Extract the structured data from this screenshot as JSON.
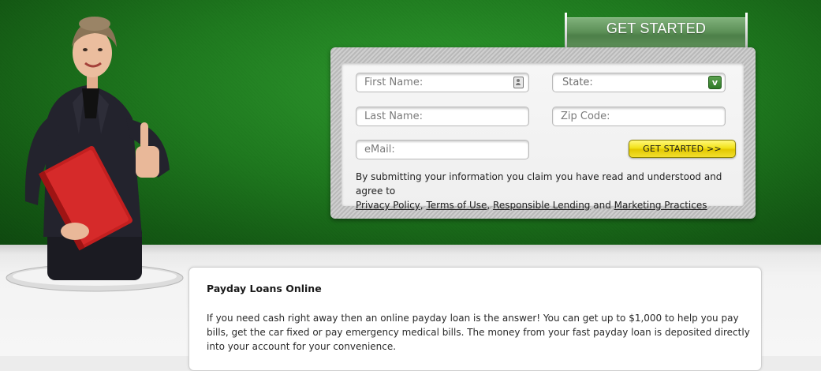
{
  "form": {
    "tab_label": "GET STARTED",
    "first_name_placeholder": "First Name:",
    "last_name_placeholder": "Last Name:",
    "email_placeholder": "eMail:",
    "state_label": "State:",
    "zip_placeholder": "Zip Code:",
    "submit_label": "GET STARTED  >>",
    "disclaimer_text": "By submitting your information you claim you have read and understood and agree to",
    "links": {
      "privacy": "Privacy Policy",
      "terms": "Terms of Use",
      "lending": "Responsible Lending",
      "marketing": "Marketing Practices"
    },
    "sep_comma": ",",
    "sep_and": "and"
  },
  "content": {
    "title": "Payday Loans Online",
    "body": "If you need cash right away then an online payday loan is the answer! You can get up to $1,000 to help you pay bills, get the car fixed or pay emergency medical bills. The money from your fast payday loan is deposited directly into your account for your convenience."
  },
  "colors": {
    "hero_green": "#1f7a1f",
    "button_yellow": "#f2e21a",
    "tab_green": "#5b8f56"
  },
  "icons": {
    "first_name_field": "contact-card-icon",
    "state_field": "dropdown-arrow-icon"
  }
}
